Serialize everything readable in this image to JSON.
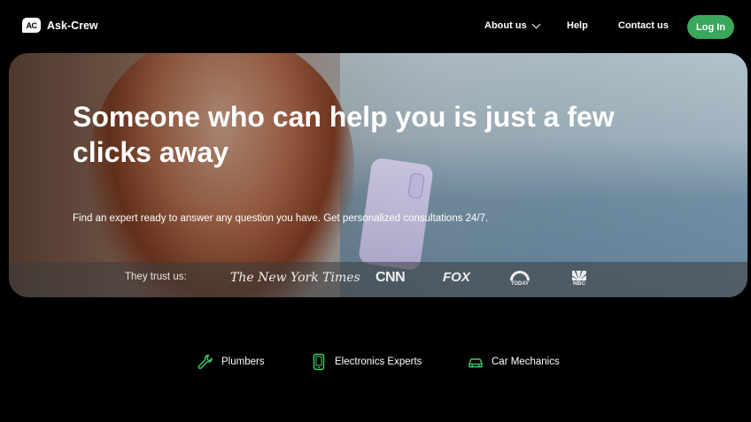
{
  "header": {
    "brand_mark": "AC",
    "brand_name": "Ask-Crew",
    "nav": {
      "about": "About us",
      "help": "Help",
      "contact": "Contact us",
      "login": "Log In"
    }
  },
  "hero": {
    "title": "Someone who can help you is just a few clicks away",
    "subtitle": "Find an expert ready to answer any question you have. Get personalized consultations 24/7.",
    "trust_label": "They trust us:",
    "brands": {
      "nyt": "The New York Times",
      "cnn": "CNN",
      "fox": "FOX",
      "today": "TODAY",
      "nbc": "NBC"
    }
  },
  "categories": {
    "plumbers": "Plumbers",
    "electronics": "Electronics Experts",
    "mechanics": "Car Mechanics"
  },
  "colors": {
    "accent": "#3aa85a",
    "icon": "#3ecf6a",
    "background": "#000000"
  }
}
